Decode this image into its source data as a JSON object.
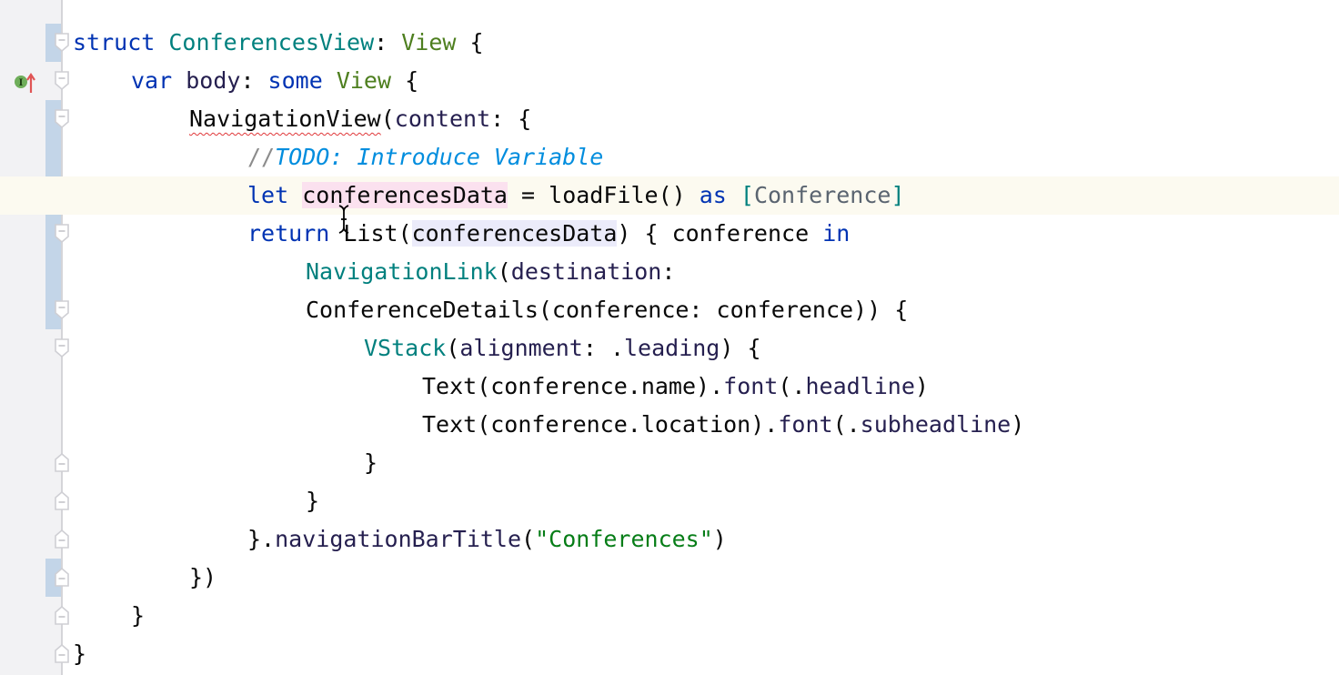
{
  "editor": {
    "language": "swift",
    "current_line": 5,
    "lines": [
      {
        "n": 1,
        "indent": 0,
        "tokens": [
          [
            "kw",
            "struct "
          ],
          [
            "type",
            "ConferencesView"
          ],
          [
            "",
            ""
          ],
          [
            "",
            ": "
          ],
          [
            "view",
            "View"
          ],
          [
            "",
            " {"
          ]
        ]
      },
      {
        "n": 2,
        "indent": 1,
        "tokens": [
          [
            "kw",
            "var "
          ],
          [
            "fn",
            "body"
          ],
          [
            "",
            ": "
          ],
          [
            "kw",
            "some "
          ],
          [
            "view",
            "View"
          ],
          [
            "",
            " {"
          ]
        ]
      },
      {
        "n": 3,
        "indent": 2,
        "tokens": [
          [
            "squiggle",
            "NavigationView"
          ],
          [
            "",
            "("
          ],
          [
            "fn",
            "content"
          ],
          [
            "",
            ": {"
          ]
        ]
      },
      {
        "n": 4,
        "indent": 3,
        "tokens": [
          [
            "cm",
            "//"
          ],
          [
            "todo",
            "TODO: Introduce Variable"
          ]
        ]
      },
      {
        "n": 5,
        "indent": 3,
        "tokens": [
          [
            "kw",
            "let "
          ],
          [
            "hl-write",
            "conferencesData"
          ],
          [
            "",
            " = "
          ],
          [
            "",
            "loadFile() "
          ],
          [
            "kw",
            "as "
          ],
          [
            "bracket",
            "["
          ],
          [
            "gray",
            "Conference"
          ],
          [
            "bracket",
            "]"
          ]
        ]
      },
      {
        "n": 6,
        "indent": 3,
        "tokens": [
          [
            "kw",
            "return "
          ],
          [
            "",
            "List("
          ],
          [
            "hl-read",
            "conferencesData"
          ],
          [
            "",
            ") { conference "
          ],
          [
            "kw",
            "in"
          ]
        ]
      },
      {
        "n": 7,
        "indent": 4,
        "tokens": [
          [
            "type",
            "NavigationLink"
          ],
          [
            "",
            "("
          ],
          [
            "fn",
            "destination"
          ],
          [
            "",
            ":"
          ]
        ]
      },
      {
        "n": 8,
        "indent": 4,
        "tokens": [
          [
            "",
            "ConferenceDetails(conference: conference)) {"
          ]
        ]
      },
      {
        "n": 9,
        "indent": 5,
        "tokens": [
          [
            "type",
            "VStack"
          ],
          [
            "",
            "("
          ],
          [
            "fn",
            "alignment"
          ],
          [
            "",
            ": ."
          ],
          [
            "fn",
            "leading"
          ],
          [
            "",
            ") {"
          ]
        ]
      },
      {
        "n": 10,
        "indent": 6,
        "tokens": [
          [
            "",
            "Text(conference.name)."
          ],
          [
            "fn",
            "font"
          ],
          [
            "",
            "(."
          ],
          [
            "fn",
            "headline"
          ],
          [
            "",
            ")"
          ]
        ]
      },
      {
        "n": 11,
        "indent": 6,
        "tokens": [
          [
            "",
            "Text(conference.location)."
          ],
          [
            "fn",
            "font"
          ],
          [
            "",
            "(."
          ],
          [
            "fn",
            "subheadline"
          ],
          [
            "",
            ")"
          ]
        ]
      },
      {
        "n": 12,
        "indent": 5,
        "tokens": [
          [
            "",
            "}"
          ]
        ]
      },
      {
        "n": 13,
        "indent": 4,
        "tokens": [
          [
            "",
            "}"
          ]
        ]
      },
      {
        "n": 14,
        "indent": 3,
        "tokens": [
          [
            "",
            "}."
          ],
          [
            "fn",
            "navigationBarTitle"
          ],
          [
            "",
            "("
          ],
          [
            "str",
            "\"Conferences\""
          ],
          [
            "",
            ")"
          ]
        ]
      },
      {
        "n": 15,
        "indent": 2,
        "tokens": [
          [
            "",
            "})"
          ]
        ]
      },
      {
        "n": 16,
        "indent": 1,
        "tokens": [
          [
            "",
            "}"
          ]
        ]
      },
      {
        "n": 17,
        "indent": 0,
        "tokens": [
          [
            "",
            "}"
          ]
        ]
      }
    ],
    "fold_markers": [
      {
        "line": 1,
        "kind": "open"
      },
      {
        "line": 2,
        "kind": "open"
      },
      {
        "line": 3,
        "kind": "open"
      },
      {
        "line": 6,
        "kind": "open"
      },
      {
        "line": 8,
        "kind": "open"
      },
      {
        "line": 9,
        "kind": "open"
      },
      {
        "line": 12,
        "kind": "close"
      },
      {
        "line": 13,
        "kind": "close"
      },
      {
        "line": 14,
        "kind": "close"
      },
      {
        "line": 15,
        "kind": "close"
      },
      {
        "line": 16,
        "kind": "close"
      },
      {
        "line": 17,
        "kind": "close"
      }
    ],
    "change_ranges": [
      [
        1,
        1
      ],
      [
        3,
        8
      ],
      [
        15,
        15
      ]
    ],
    "gutter_marker": {
      "line": 2,
      "icon": "implements-overrides-icon",
      "label": "I"
    }
  },
  "colors": {
    "keyword": "#0033b3",
    "type": "#00807e",
    "protocol": "#4e7f1f",
    "function": "#251f4f",
    "string": "#067d17",
    "comment": "#8c8c8c",
    "todo": "#008dde",
    "current_line": "#fcfaf0",
    "write_highlight": "#fbe1ef",
    "read_highlight": "#ebebfa",
    "change_bar": "#c3d5e8"
  }
}
